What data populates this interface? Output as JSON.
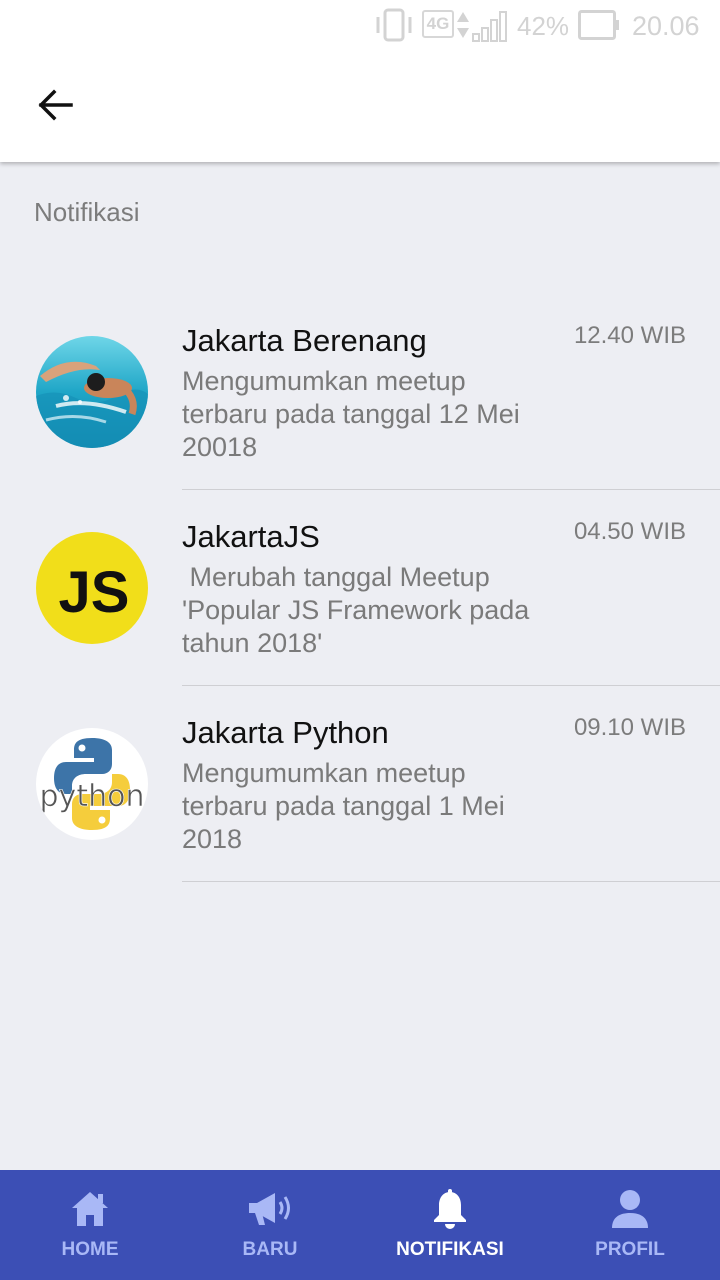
{
  "status_bar": {
    "network": "4G",
    "battery_percent": "42%",
    "time": "20.06",
    "icons": [
      "vibrate-icon",
      "network-arrows-icon",
      "signal-icon",
      "battery-icon"
    ]
  },
  "app_bar": {
    "back_icon": "arrow-back-icon"
  },
  "section_title": "Notifikasi",
  "notifications": [
    {
      "title": "Jakarta Berenang",
      "message": "Mengumumkan meetup terbaru pada tanggal 12 Mei 20018",
      "time": "12.40 WIB",
      "avatar": "swimmer-photo"
    },
    {
      "title": "JakartaJS",
      "message": " Merubah tanggal Meetup 'Popular JS Framework pada tahun 2018'",
      "time": "04.50 WIB",
      "avatar": "js-logo"
    },
    {
      "title": "Jakarta Python",
      "message": "Mengumumkan meetup terbaru pada tanggal 1 Mei 2018",
      "time": "09.10 WIB",
      "avatar": "python-logo"
    }
  ],
  "bottom_nav": {
    "items": [
      {
        "label": "HOME",
        "icon": "home-icon",
        "active": false
      },
      {
        "label": "BARU",
        "icon": "megaphone-icon",
        "active": false
      },
      {
        "label": "NOTIFIKASI",
        "icon": "bell-icon",
        "active": true
      },
      {
        "label": "PROFIL",
        "icon": "person-icon",
        "active": false
      }
    ]
  },
  "colors": {
    "nav_background": "#3c4fb5",
    "nav_active": "#ffffff",
    "nav_inactive": "#a9b8f6",
    "page_background": "#edeef3",
    "js_yellow": "#f1de1a",
    "python_blue": "#3d74a8",
    "python_yellow": "#f5cd3c"
  }
}
